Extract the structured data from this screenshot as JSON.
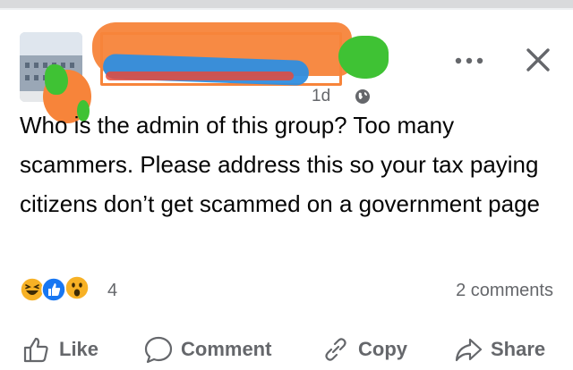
{
  "post": {
    "timestamp": "1d",
    "text": "Who is the admin of this group?  Too many scammers. Please address this so your tax paying citizens don’t get scammed on a government page"
  },
  "header": {
    "more_icon": "more-horizontal-icon",
    "close_icon": "close-icon",
    "privacy_icon": "globe-icon"
  },
  "reactions": {
    "icons": [
      "haha-icon",
      "like-icon",
      "wow-icon"
    ],
    "count": "4"
  },
  "comments": {
    "count_label": "2 comments"
  },
  "actions": {
    "like": "Like",
    "comment": "Comment",
    "copy": "Copy",
    "share": "Share"
  },
  "colors": {
    "text_primary": "#050505",
    "text_secondary": "#65676b",
    "like_blue": "#1877f2",
    "reaction_yellow": "#f7b125"
  }
}
